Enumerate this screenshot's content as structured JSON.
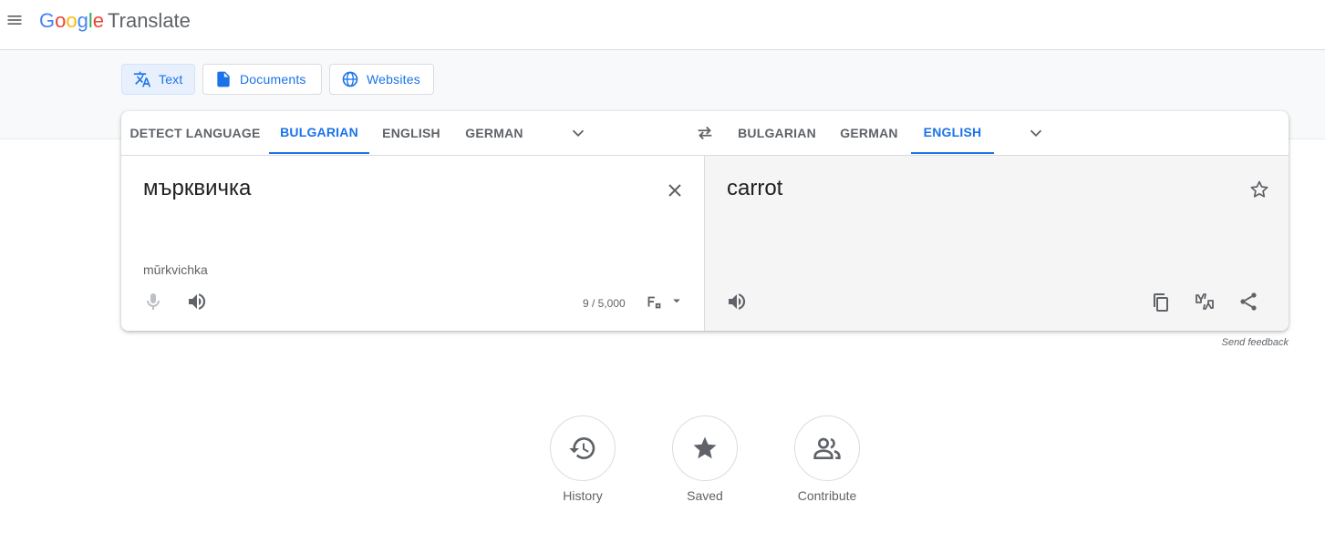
{
  "header": {
    "logo_letters": [
      "G",
      "o",
      "o",
      "g",
      "l",
      "e"
    ],
    "product": "Translate"
  },
  "modes": {
    "text": "Text",
    "documents": "Documents",
    "websites": "Websites",
    "active": "text"
  },
  "source_languages": {
    "tabs": [
      "DETECT LANGUAGE",
      "BULGARIAN",
      "ENGLISH",
      "GERMAN"
    ],
    "selected": "BULGARIAN"
  },
  "target_languages": {
    "tabs": [
      "BULGARIAN",
      "GERMAN",
      "ENGLISH"
    ],
    "selected": "ENGLISH"
  },
  "source": {
    "text": "мърквичка",
    "transliteration": "mŭrkvichka",
    "char_count": "9 / 5,000"
  },
  "target": {
    "text": "carrot"
  },
  "feedback_label": "Send feedback",
  "bottom_actions": {
    "history": "History",
    "saved": "Saved",
    "contribute": "Contribute"
  },
  "colors": {
    "accent": "#1a73e8",
    "target_bg": "#f5f5f5"
  }
}
